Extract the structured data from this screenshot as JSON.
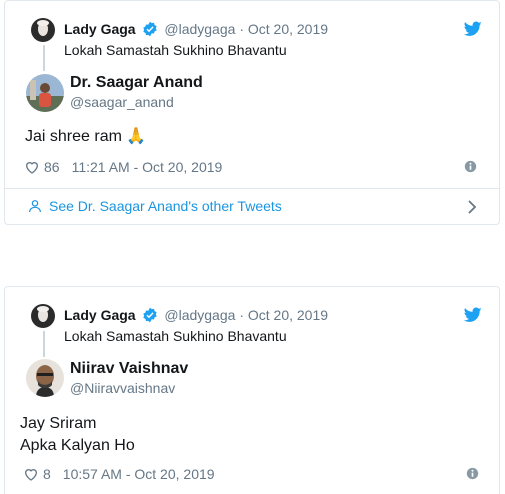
{
  "tweets": [
    {
      "quoted": {
        "name": "Lady Gaga",
        "handle": "@ladygaga",
        "date": "· Oct 20, 2019",
        "text": "Lokah Samastah Sukhino Bhavantu"
      },
      "reply": {
        "name": "Dr. Saagar Anand",
        "handle": "@saagar_anand",
        "text": "Jai shree ram 🙏"
      },
      "likes": "86",
      "timestamp": "11:21 AM - Oct 20, 2019",
      "see_other": "See Dr. Saagar Anand's other Tweets"
    },
    {
      "quoted": {
        "name": "Lady Gaga",
        "handle": "@ladygaga",
        "date": "· Oct 20, 2019",
        "text": "Lokah Samastah Sukhino Bhavantu"
      },
      "reply": {
        "name": "Niirav Vaishnav",
        "handle": "@Niiravvaishnav",
        "text_line1": "Jay Sriram",
        "text_line2": "Apka Kalyan Ho"
      },
      "likes": "8",
      "timestamp": "10:57 AM - Oct 20, 2019"
    }
  ],
  "colors": {
    "twitter_blue": "#1da1f2",
    "link_blue": "#1b95e0",
    "muted": "#657786",
    "border": "#e1e8ed"
  },
  "icons": [
    "twitter-bird-icon",
    "verified-badge-icon",
    "heart-icon",
    "info-icon",
    "person-icon",
    "chevron-right-icon"
  ]
}
